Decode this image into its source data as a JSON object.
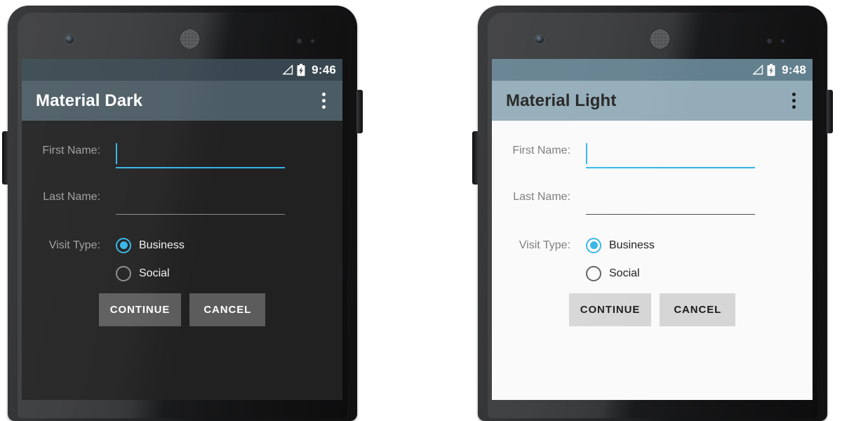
{
  "page": {
    "background": "#ffffff",
    "accent": "#33b5e5",
    "description": "Side-by-side Android phone mockups comparing Material Dark and Material Light themes of the same form screen"
  },
  "phones": [
    {
      "theme": "dark",
      "status_bar": {
        "time": "9:46",
        "signal_icon": "signal-triangle-icon",
        "battery_icon": "battery-charging-icon",
        "background": "#38474f",
        "text_color": "#ffffff"
      },
      "action_bar": {
        "title": "Material Dark",
        "overflow_icon": "overflow-menu-icon",
        "background": "#4c5c64",
        "text_color": "#ffffff"
      },
      "content": {
        "background": "#212121",
        "fields": [
          {
            "label": "First Name:",
            "value": "",
            "focused": true,
            "underline_color": "#33b5e5"
          },
          {
            "label": "Last Name:",
            "value": "",
            "focused": false,
            "underline_color": "#8a8a8a"
          }
        ],
        "radio_group": {
          "label": "Visit Type:",
          "options": [
            {
              "label": "Business",
              "selected": true
            },
            {
              "label": "Social",
              "selected": false
            }
          ]
        },
        "buttons": [
          {
            "label": "CONTINUE",
            "name": "continue-button"
          },
          {
            "label": "CANCEL",
            "name": "cancel-button"
          }
        ]
      }
    },
    {
      "theme": "light",
      "status_bar": {
        "time": "9:48",
        "signal_icon": "signal-triangle-icon",
        "battery_icon": "battery-charging-icon",
        "background": "#63808e",
        "text_color": "#ffffff"
      },
      "action_bar": {
        "title": "Material Light",
        "overflow_icon": "overflow-menu-icon",
        "background": "#93acb8",
        "text_color": "#212121"
      },
      "content": {
        "background": "#fafafa",
        "fields": [
          {
            "label": "First Name:",
            "value": "",
            "focused": true,
            "underline_color": "#33b5e5"
          },
          {
            "label": "Last Name:",
            "value": "",
            "focused": false,
            "underline_color": "#4a4a4a"
          }
        ],
        "radio_group": {
          "label": "Visit Type:",
          "options": [
            {
              "label": "Business",
              "selected": true
            },
            {
              "label": "Social",
              "selected": false
            }
          ]
        },
        "buttons": [
          {
            "label": "CONTINUE",
            "name": "continue-button"
          },
          {
            "label": "CANCEL",
            "name": "cancel-button"
          }
        ]
      }
    }
  ],
  "hardware": {
    "front_camera_icon": "front-camera-icon",
    "earpiece_icon": "earpiece-speaker-icon",
    "sensor_icon": "proximity-sensor-icon",
    "volume_button": "volume-rocker-button",
    "power_button": "power-button"
  }
}
